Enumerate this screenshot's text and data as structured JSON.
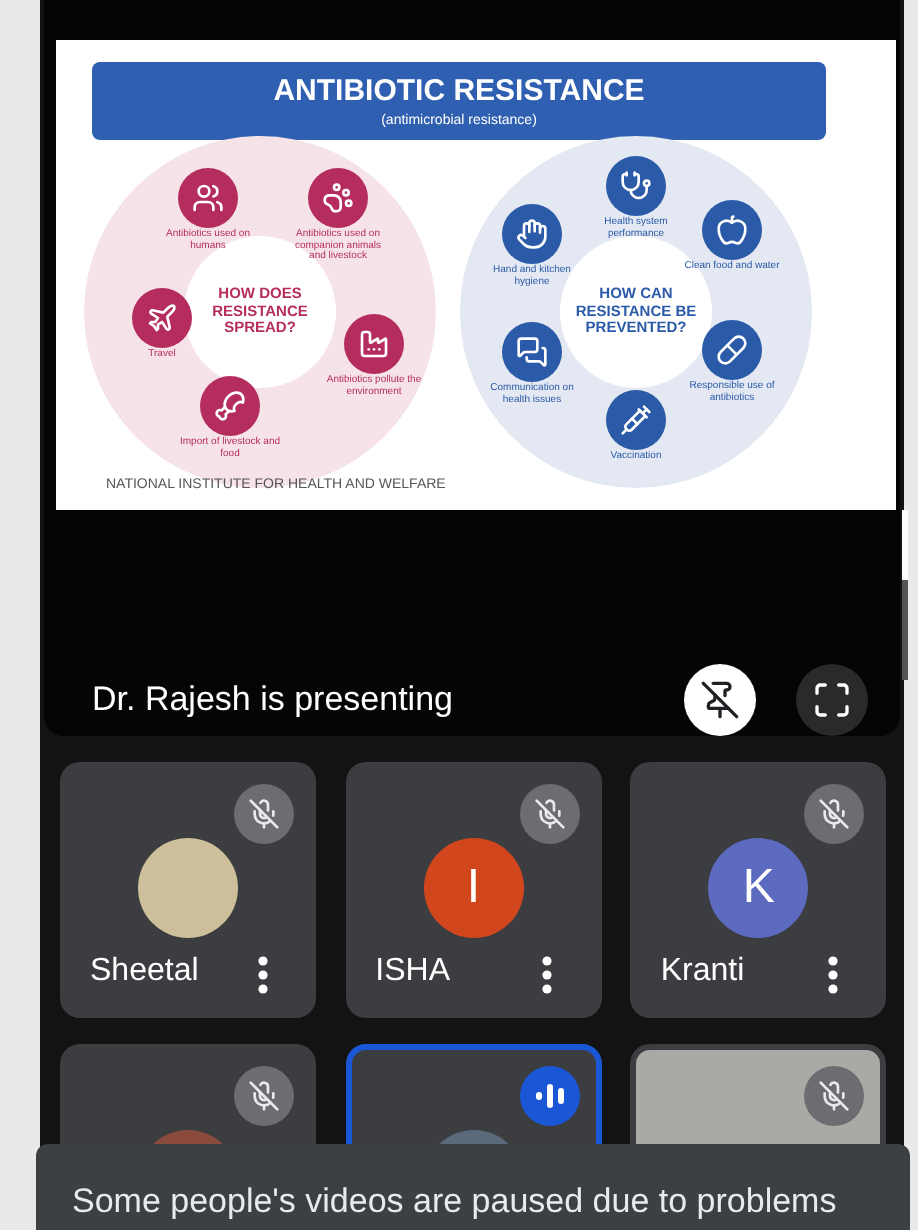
{
  "presentation": {
    "slide": {
      "title": "ANTIBIOTIC RESISTANCE",
      "subtitle": "(antimicrobial resistance)",
      "spread": {
        "center": "HOW DOES RESISTANCE SPREAD?",
        "items": [
          "Antibiotics used on humans",
          "Antibiotics used on companion animals and livestock",
          "Travel",
          "Antibiotics pollute the environment",
          "Import of livestock and food"
        ]
      },
      "prevention": {
        "center": "HOW CAN RESISTANCE BE PREVENTED?",
        "items": [
          "Health system performance",
          "Hand and kitchen hygiene",
          "Clean food and water",
          "Communication on health issues",
          "Responsible use of antibiotics",
          "Vaccination"
        ]
      },
      "footer": "NATIONAL INSTITUTE FOR HEALTH AND WELFARE"
    },
    "caption": "Dr. Rajesh is presenting"
  },
  "participants": [
    {
      "kind": "photo",
      "name": "Sheetal",
      "muted": true
    },
    {
      "kind": "initial",
      "name": "ISHA",
      "initial": "I",
      "color": "#d2461d",
      "muted": true
    },
    {
      "kind": "initial",
      "name": "Kranti",
      "initial": "K",
      "color": "#5c6bc0",
      "muted": true
    },
    {
      "kind": "hidden",
      "color": "#8a4b3c",
      "muted": true
    },
    {
      "kind": "hidden",
      "color": "#5a6a7a",
      "muted": false,
      "speaking": true
    },
    {
      "kind": "video",
      "muted": true
    }
  ],
  "toast": "Some people's videos are paused due to problems"
}
